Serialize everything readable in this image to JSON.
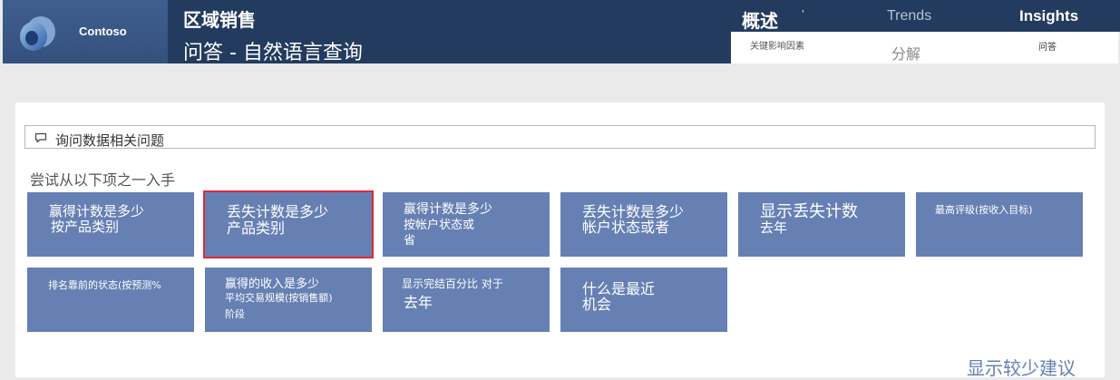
{
  "header": {
    "brand": "Contoso",
    "report_title": "区域销售",
    "page_title": "问答 - 自然语言查询",
    "nav": {
      "overview": "概述",
      "tick": "'",
      "trends": "Trends",
      "insights": "Insights",
      "key_influencers": "关键影响因素",
      "decomposition": "分解",
      "qna": "问答"
    }
  },
  "qna": {
    "placeholder": "询问数据相关问题",
    "try_label": "尝试从以下项之一入手",
    "show_less": "显示较少建议"
  },
  "suggestions": [
    {
      "lines": [
        "赢得计数是多少",
        "按产品类别"
      ]
    },
    {
      "lines": [
        "丢失计数是多少",
        "产品类别"
      ],
      "selected": true
    },
    {
      "lines": [
        "赢得计数是多少",
        "按帐户状态或",
        "省"
      ]
    },
    {
      "lines": [
        "丢失计数是多少",
        "帐户状态或者"
      ]
    },
    {
      "lines": [
        "显示丢失计数",
        "去年"
      ]
    },
    {
      "lines": [
        "最高评级(按收入目标)"
      ]
    },
    {
      "lines": [
        "排名靠前的状态(按预测%"
      ]
    },
    {
      "lines": [
        "赢得的收入是多少",
        "平均交易规模(按销售额)",
        "阶段"
      ]
    },
    {
      "lines": [
        "显示完结百分比   对于",
        "去年"
      ]
    },
    {
      "lines": [
        "什么是最近",
        "机会"
      ]
    }
  ],
  "colors": {
    "header_dark": "#233b5e",
    "logo_bg": "#3f5f8f",
    "tile_bg": "#6680b3",
    "selected_outline": "#e0283c",
    "page_bg": "#eaeaea"
  },
  "icons": {
    "logo": "contoso-logo-icon",
    "input": "chat-bubble-icon"
  }
}
